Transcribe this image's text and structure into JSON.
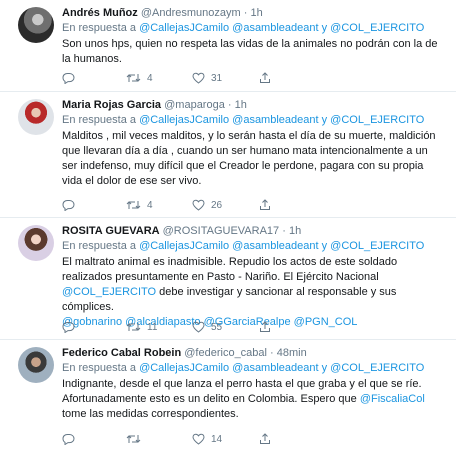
{
  "tweets": [
    {
      "name": "Andrés Muñoz",
      "handle": "@Andresmunozaym",
      "separator": "·",
      "time": "1h",
      "reply_prefix": "En respuesta a",
      "reply_mention1": "@CallejasJCamilo",
      "reply_mention2": "@asambleadeant",
      "reply_and": "y",
      "reply_mention3": "@COL_EJERCITO",
      "text_lines": [
        "Son unos hps, quien no respeta las vidas de la animales no podrán con la de",
        "la humanos."
      ],
      "retweets": "4",
      "likes": "31"
    },
    {
      "name": "Maria Rojas Garcia",
      "handle": "@maparoga",
      "separator": "·",
      "time": "1h",
      "reply_prefix": "En respuesta a",
      "reply_mention1": "@CallejasJCamilo",
      "reply_mention2": "@asambleadeant",
      "reply_and": "y",
      "reply_mention3": "@COL_EJERCITO",
      "text_lines": [
        "Malditos , mil veces malditos, y lo serán hasta el día de su muerte, maldición",
        "que llevaran día a día , cuando un ser humano mata intencionalmente a un",
        "ser indefenso, muy difícil que el Creador le perdone, pagara con su propia",
        "vida el dolor de ese ser vivo."
      ],
      "retweets": "4",
      "likes": "26"
    },
    {
      "name": "ROSITA GUEVARA",
      "handle": "@ROSITAGUEVARA17",
      "separator": "·",
      "time": "1h",
      "reply_prefix": "En respuesta a",
      "reply_mention1": "@CallejasJCamilo",
      "reply_mention2": "@asambleadeant",
      "reply_and": "y",
      "reply_mention3": "@COL_EJERCITO",
      "line1": "El maltrato animal es inadmisible. Repudio los actos de este soldado",
      "line2": "realizados presuntamente en Pasto - Nariño. El Ejército Nacional",
      "line3_mention": "@COL_EJERCITO",
      "line3_rest": " debe investigar y sancionar al responsable y sus cómplices.",
      "line4_mentions": [
        "@gobnarino",
        "@alcaldiapasto",
        "@GGarciaRealpe",
        "@PGN_COL"
      ],
      "retweets": "11",
      "likes": "55"
    },
    {
      "name": "Federico Cabal Robein",
      "handle": "@federico_cabal",
      "separator": "·",
      "time": "48min",
      "reply_prefix": "En respuesta a",
      "reply_mention1": "@CallejasJCamilo",
      "reply_mention2": "@asambleadeant",
      "reply_and": "y",
      "reply_mention3": "@COL_EJERCITO",
      "line1": "Indignante, desde el que lanza el perro hasta el que graba y el que se ríe.",
      "line2_text": "Afortunadamente esto es un delito en Colombia. Espero que ",
      "line2_mention": "@FiscaliaCol",
      "line3": "tome las medidas correspondientes.",
      "retweets": "",
      "likes": "14"
    }
  ],
  "colors": {
    "link": "#1b95e0",
    "muted": "#657786",
    "text": "#14171a",
    "divider": "#e6ecf0"
  },
  "icons": [
    "reply-icon",
    "retweet-icon",
    "like-icon",
    "share-icon"
  ]
}
